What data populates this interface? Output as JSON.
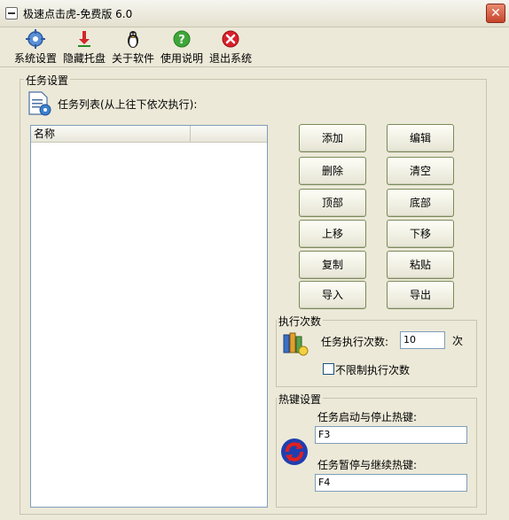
{
  "window": {
    "title": "极速点击虎-免费版 6.0",
    "close_label": "✕"
  },
  "toolbar": {
    "items": [
      {
        "label": "系统设置",
        "icon": "gear-icon"
      },
      {
        "label": "隐藏托盘",
        "icon": "download-arrow-icon"
      },
      {
        "label": "关于软件",
        "icon": "penguin-icon"
      },
      {
        "label": "使用说明",
        "icon": "help-icon"
      },
      {
        "label": "退出系统",
        "icon": "exit-icon"
      }
    ]
  },
  "tasks": {
    "group_label": "任务设置",
    "list_caption": "任务列表(从上往下依次执行):",
    "list_columns": [
      "名称",
      ""
    ],
    "buttons": {
      "add": "添加",
      "edit": "编辑",
      "delete": "删除",
      "clear": "清空",
      "top": "顶部",
      "bottom": "底部",
      "up": "上移",
      "down": "下移",
      "copy": "复制",
      "paste": "粘贴",
      "import": "导入",
      "export": "导出"
    }
  },
  "exec": {
    "group_label": "执行次数",
    "count_label": "任务执行次数:",
    "count_value": "10",
    "count_unit": "次",
    "unlimited_label": "不限制执行次数",
    "unlimited_checked": false
  },
  "hotkeys": {
    "group_label": "热键设置",
    "start_stop_label": "任务启动与停止热键:",
    "start_stop_value": "F3",
    "pause_resume_label": "任务暂停与继续热键:",
    "pause_resume_value": "F4"
  }
}
